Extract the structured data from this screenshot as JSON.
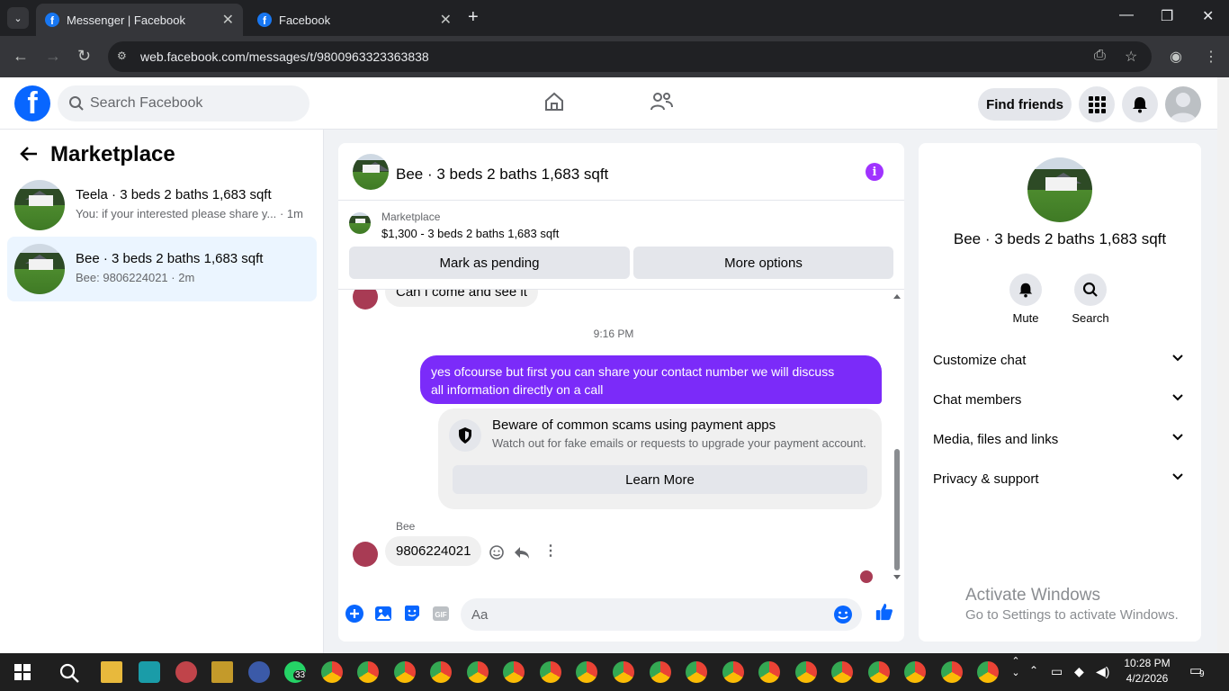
{
  "browser": {
    "tabs": [
      {
        "title": "Messenger | Facebook",
        "active": true
      },
      {
        "title": "Facebook",
        "active": false
      }
    ],
    "url": "web.facebook.com/messages/t/9800963323363838"
  },
  "fb_header": {
    "search_placeholder": "Search Facebook",
    "find_friends": "Find friends"
  },
  "left_panel": {
    "title": "Marketplace",
    "conversations": [
      {
        "name": "Teela · 3 beds 2 baths 1,683 sqft",
        "preview": "You: if your interested please share y...",
        "time": "· 1m"
      },
      {
        "name": "Bee · 3 beds 2 baths 1,683 sqft",
        "preview": "Bee: 9806224021",
        "time": "· 2m"
      }
    ]
  },
  "chat": {
    "title": "Bee · 3 beds 2 baths 1,683 sqft",
    "marketplace_label": "Marketplace",
    "listing": "$1,300 - 3 beds 2 baths 1,683 sqft",
    "mark_pending": "Mark as pending",
    "more_options": "More options",
    "messages": {
      "incoming_1": "Can I come and see it",
      "timestamp": "9:16 PM",
      "outgoing_1_line1": "yes ofcourse but first you can share your contact number we will discuss",
      "outgoing_1_line2": "all information directly on a call",
      "warning_title": "Beware of common scams using payment apps",
      "warning_sub": "Watch out for fake emails or requests to upgrade your payment account.",
      "learn_more": "Learn More",
      "sender": "Bee",
      "incoming_2": "9806224021"
    },
    "composer_placeholder": "Aa"
  },
  "right_panel": {
    "title": "Bee · 3 beds 2 baths 1,683 sqft",
    "mute": "Mute",
    "search": "Search",
    "sections": [
      "Customize chat",
      "Chat members",
      "Media, files and links",
      "Privacy & support"
    ]
  },
  "watermark": {
    "line1": "Activate Windows",
    "line2": "Go to Settings to activate Windows."
  },
  "taskbar": {
    "time": "10:28 PM",
    "date": "4/2/2026",
    "whatsapp_badge": "33",
    "notification_badge": "9"
  },
  "colors": {
    "fb_blue": "#0866ff",
    "outgoing_bubble": "#7b2bf9",
    "selected_conv": "#ebf5ff"
  }
}
